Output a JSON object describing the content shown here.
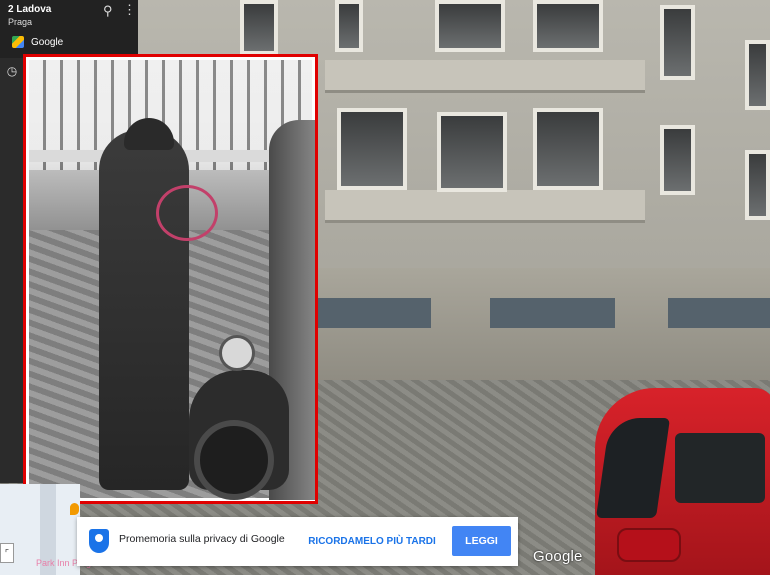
{
  "location": {
    "address": "2 Ladova",
    "city": "Praga"
  },
  "header": {
    "pin_icon": "location-pin-icon",
    "menu_icon": "more-vert-icon"
  },
  "app": {
    "name": "Google",
    "icon": "google-maps-icon"
  },
  "sidebar": {
    "history_icon": "clock-icon"
  },
  "minimap": {
    "label": "Park Inn Prague"
  },
  "privacy_toast": {
    "text": "Promemoria sulla privacy di Google",
    "later_label": "RICORDAMELO PIÙ TARDI",
    "read_label": "LEGGI",
    "icon": "shield-icon",
    "accent": "#1a73e8"
  },
  "watermark": "Google",
  "overlay": {
    "border_color": "#e00000"
  }
}
